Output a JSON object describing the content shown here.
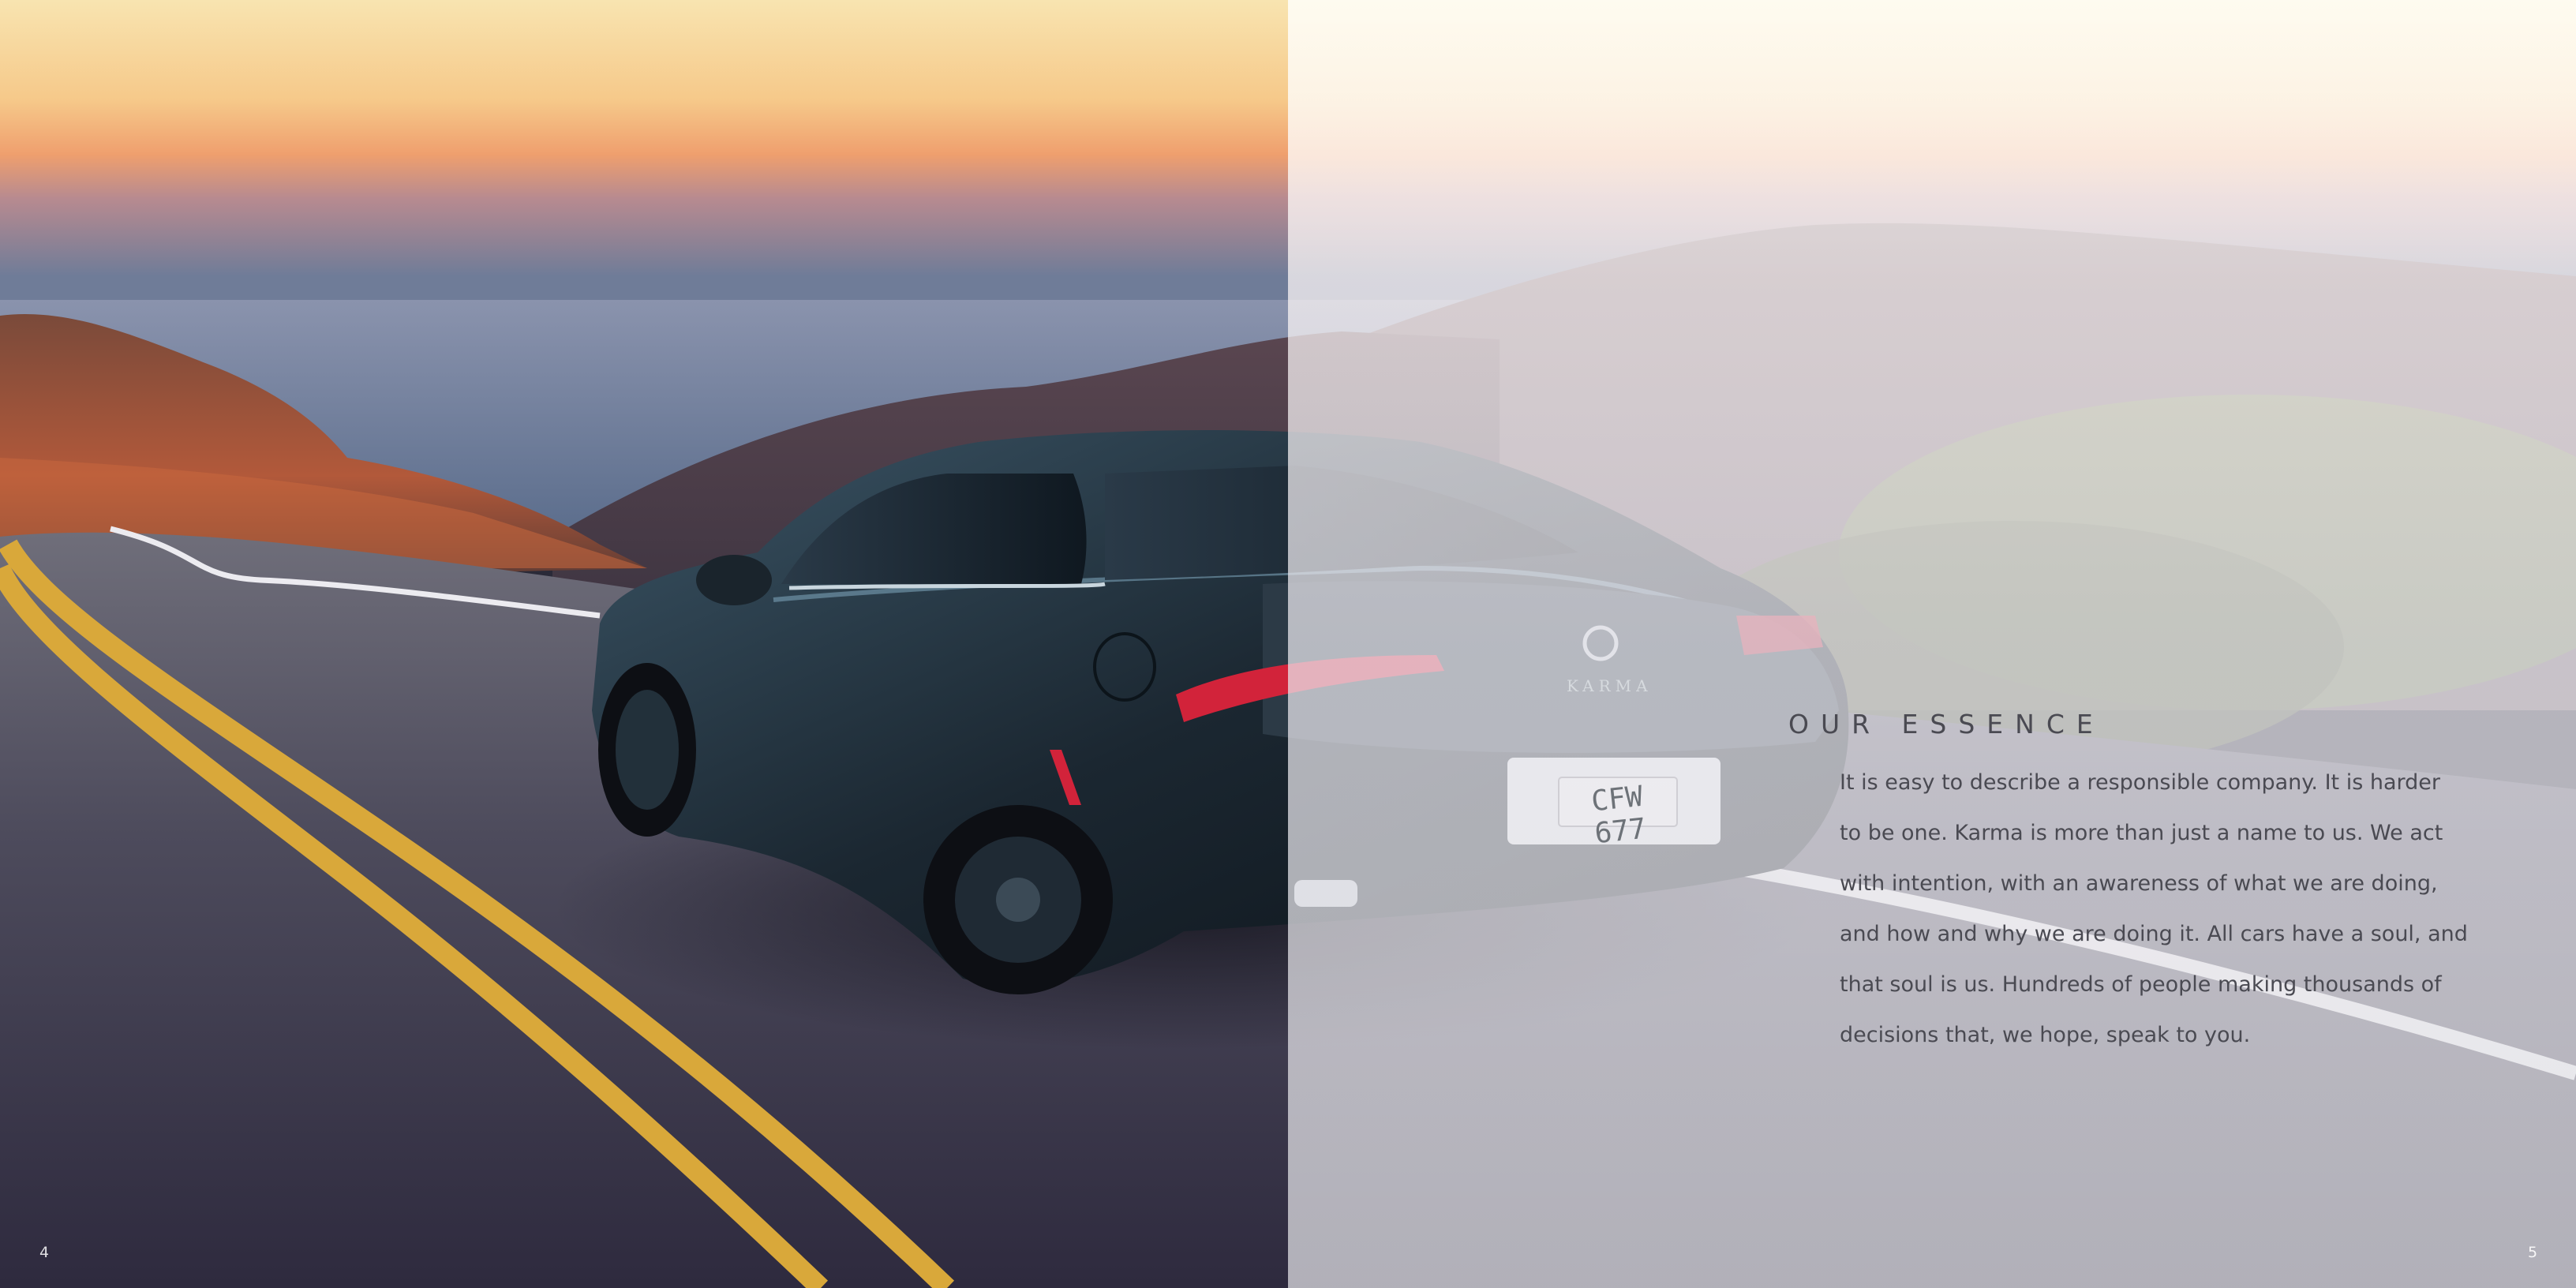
{
  "spread": {
    "left_page_number": "4",
    "right_page_number": "5"
  },
  "photo": {
    "license_plate": "CFW 677",
    "trunk_badge": "KARMA"
  },
  "essence": {
    "heading": "OUR ESSENCE",
    "body_lines": [
      "It is easy to describe a responsible company. It is harder",
      "to be one. Karma is more than just a name to us. We act",
      "with intention, with an awareness of what we are doing,",
      "and how and why we are doing it. All cars have a soul, and",
      "that soul is us. Hundreds of people making thousands of",
      "decisions that, we hope, speak to you."
    ]
  },
  "colors": {
    "text": "#4a4a52",
    "road_line": "#d9a83a",
    "sky_warm": "#f3a46a",
    "car_body": "#1e2a33",
    "tail_light": "#d2233a"
  }
}
